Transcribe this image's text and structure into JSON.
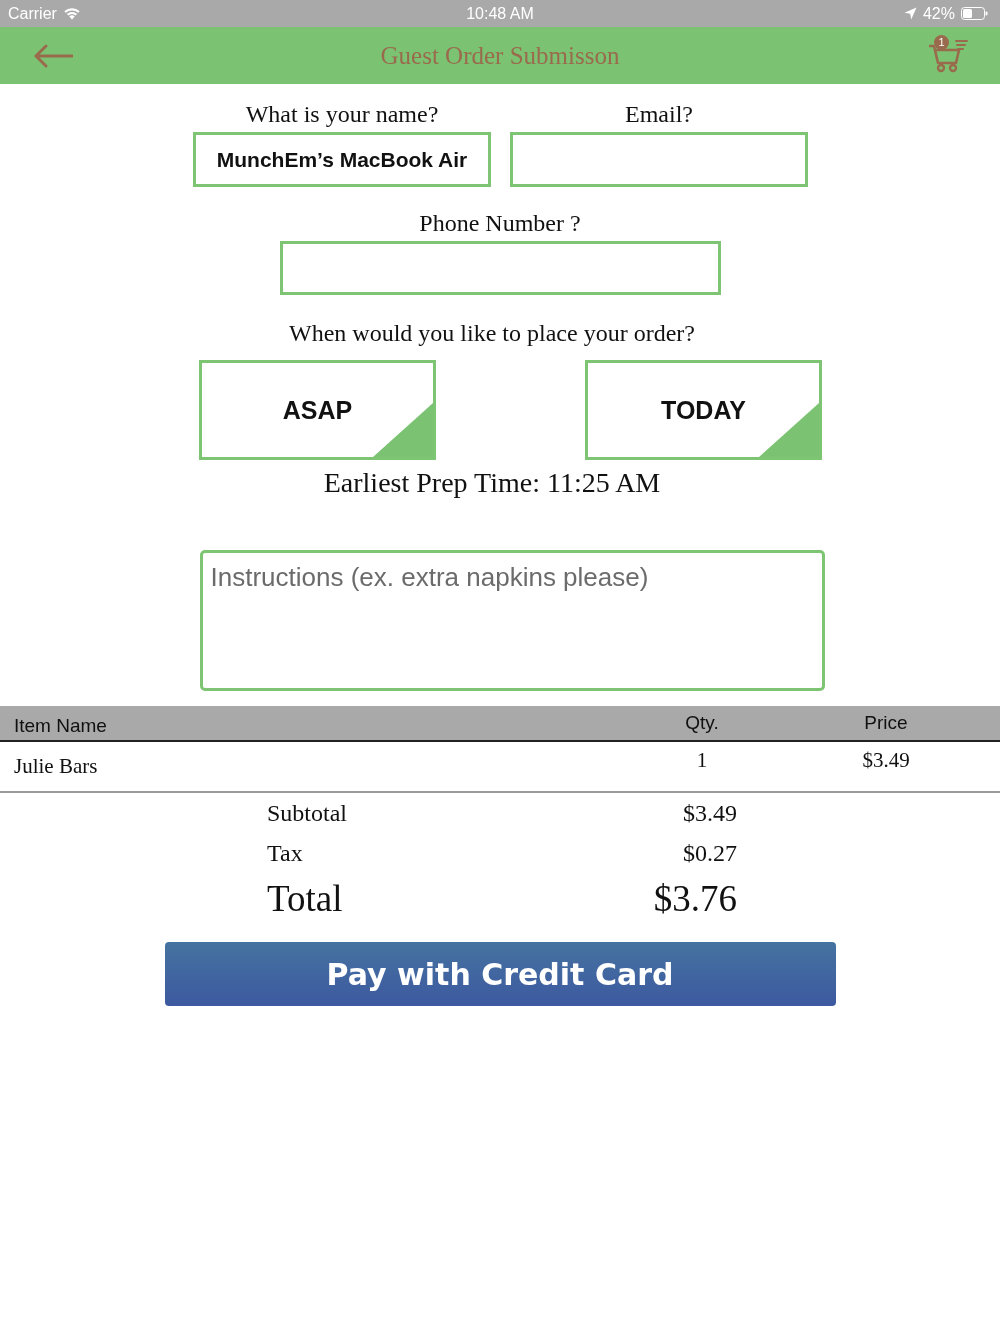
{
  "status_bar": {
    "carrier": "Carrier",
    "time": "10:48 AM",
    "battery": "42%"
  },
  "nav_bar": {
    "title": "Guest Order Submisson",
    "cart_badge": "1"
  },
  "contact_fields": [
    {
      "label": "What is your name?",
      "value": "MunchEm’s MacBook Air"
    },
    {
      "label": "Email?"
    }
  ],
  "phone_field": {
    "label": "Phone Number ?"
  },
  "order_time": {
    "question": "When would you like to place your order?",
    "options": [
      "ASAP",
      "TODAY"
    ],
    "prep_time": "Earliest Prep Time: 11:25 AM"
  },
  "instructions": {
    "placeholder": "Instructions (ex. extra napkins please)"
  },
  "table": {
    "columns": [
      "Item Name",
      "Qty.",
      "Price"
    ],
    "rows": [
      {
        "cells": [
          "Julie Bars",
          "1",
          "$3.49"
        ]
      }
    ]
  },
  "totals": [
    {
      "kind": "line",
      "label": "Subtotal",
      "amount": "$3.49"
    },
    {
      "kind": "line",
      "label": "Tax",
      "amount": "$0.27"
    },
    {
      "kind": "total",
      "label": "Total",
      "amount": "$3.76"
    }
  ],
  "pay_button": "Pay with Credit Card"
}
